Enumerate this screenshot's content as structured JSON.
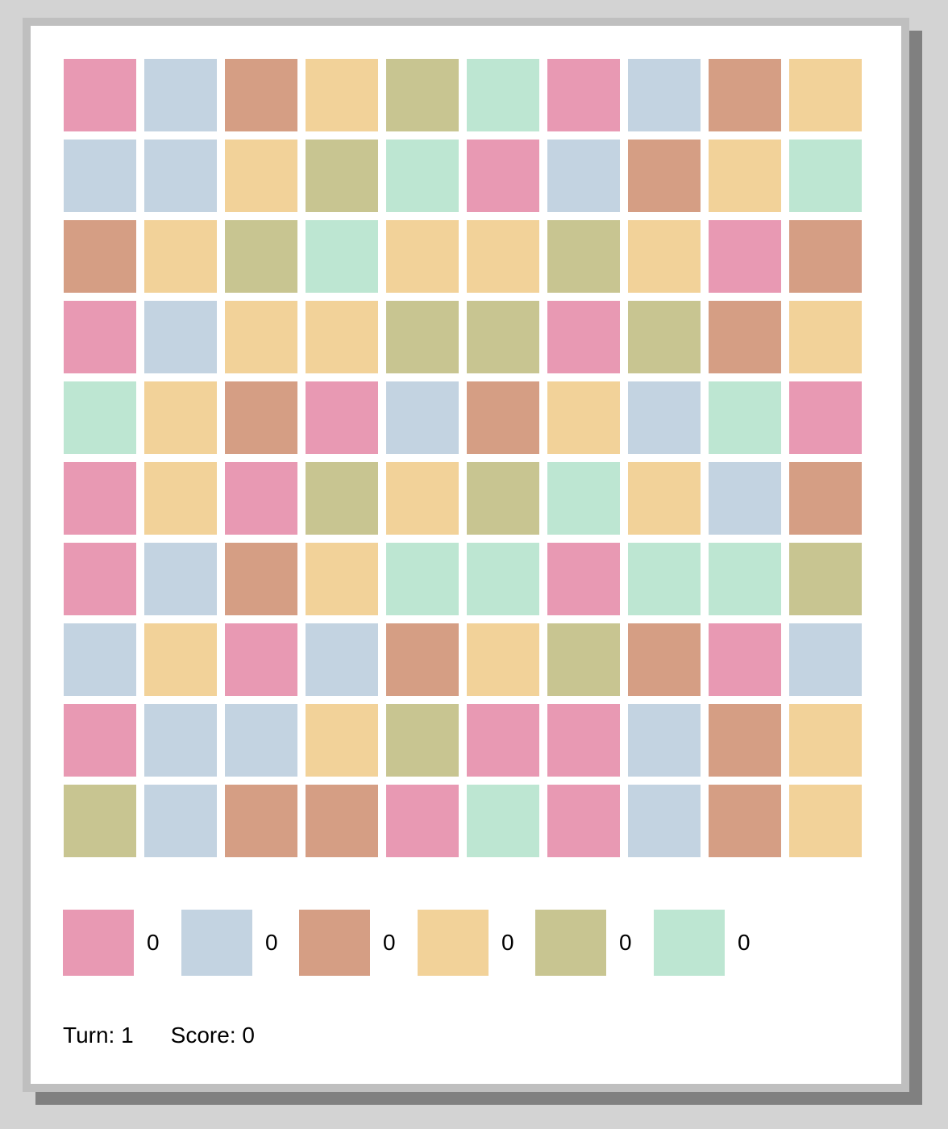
{
  "palette": [
    {
      "color": "#e899b3",
      "count": "0"
    },
    {
      "color": "#c3d3e1",
      "count": "0"
    },
    {
      "color": "#d59e84",
      "count": "0"
    },
    {
      "color": "#f2d299",
      "count": "0"
    },
    {
      "color": "#c8c591",
      "count": "0"
    },
    {
      "color": "#bde6d2",
      "count": "0"
    }
  ],
  "board": [
    [
      0,
      1,
      2,
      3,
      4,
      5,
      0,
      1,
      2,
      3
    ],
    [
      1,
      1,
      3,
      4,
      5,
      0,
      1,
      2,
      3,
      5
    ],
    [
      2,
      3,
      4,
      5,
      3,
      3,
      4,
      3,
      0,
      2
    ],
    [
      0,
      1,
      3,
      3,
      4,
      4,
      0,
      4,
      2,
      3
    ],
    [
      5,
      3,
      2,
      0,
      1,
      2,
      3,
      1,
      5,
      0
    ],
    [
      0,
      3,
      0,
      4,
      3,
      4,
      5,
      3,
      1,
      2
    ],
    [
      0,
      1,
      2,
      3,
      5,
      5,
      0,
      5,
      5,
      4
    ],
    [
      1,
      3,
      0,
      1,
      2,
      3,
      4,
      2,
      0,
      1
    ],
    [
      0,
      1,
      1,
      3,
      4,
      0,
      0,
      1,
      2,
      3
    ],
    [
      4,
      1,
      2,
      2,
      0,
      5,
      0,
      1,
      2,
      3
    ]
  ],
  "status": {
    "turn_label": "Turn: 1",
    "score_label": "Score: 0"
  }
}
